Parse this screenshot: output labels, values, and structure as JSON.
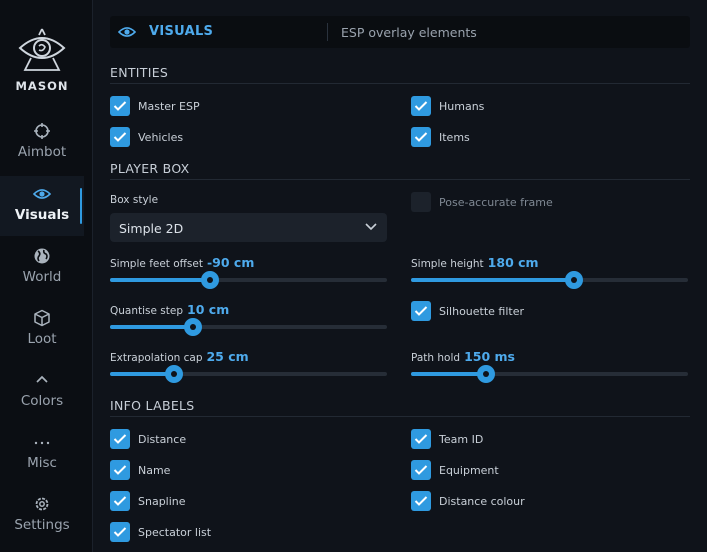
{
  "sidebar": {
    "brand": "MASON",
    "items": [
      {
        "label": "Aimbot",
        "icon": "crosshair-icon"
      },
      {
        "label": "Visuals",
        "icon": "eye-icon",
        "active": true
      },
      {
        "label": "World",
        "icon": "globe-icon"
      },
      {
        "label": "Loot",
        "icon": "box-icon"
      },
      {
        "label": "Colors",
        "icon": "chevron-up-icon"
      },
      {
        "label": "Misc",
        "icon": "dots-icon"
      },
      {
        "label": "Settings",
        "icon": "gear-icon"
      }
    ]
  },
  "header": {
    "section": "VISUALS",
    "description": "ESP overlay elements"
  },
  "entities": {
    "title": "ENTITIES",
    "master_esp": {
      "label": "Master ESP",
      "checked": true
    },
    "humans": {
      "label": "Humans",
      "checked": true
    },
    "vehicles": {
      "label": "Vehicles",
      "checked": true
    },
    "items": {
      "label": "Items",
      "checked": true
    }
  },
  "player_box": {
    "title": "PLAYER BOX",
    "box_style": {
      "label": "Box style",
      "value": "Simple 2D"
    },
    "pose_accurate": {
      "label": "Pose-accurate frame",
      "checked": false
    },
    "feet_offset": {
      "label": "Simple feet offset",
      "value": "-90 cm",
      "fraction": 0.36
    },
    "height": {
      "label": "Simple height",
      "value": "180 cm",
      "fraction": 0.59
    },
    "quantise": {
      "label": "Quantise step",
      "value": "10 cm",
      "fraction": 0.3
    },
    "silhouette": {
      "label": "Silhouette filter",
      "checked": true
    },
    "extrapolation": {
      "label": "Extrapolation cap",
      "value": "25 cm",
      "fraction": 0.23
    },
    "path_hold": {
      "label": "Path hold",
      "value": "150 ms",
      "fraction": 0.27
    }
  },
  "info_labels": {
    "title": "INFO LABELS",
    "distance": {
      "label": "Distance",
      "checked": true
    },
    "team_id": {
      "label": "Team ID",
      "checked": true
    },
    "name": {
      "label": "Name",
      "checked": true
    },
    "equipment": {
      "label": "Equipment",
      "checked": true
    },
    "snapline": {
      "label": "Snapline",
      "checked": true
    },
    "distance_colour": {
      "label": "Distance colour",
      "checked": true
    },
    "spectator_list": {
      "label": "Spectator list",
      "checked": true
    }
  },
  "colors": {
    "accent": "#2f9ae0",
    "background": "#0f131a",
    "sidebar": "#0b0e13"
  }
}
